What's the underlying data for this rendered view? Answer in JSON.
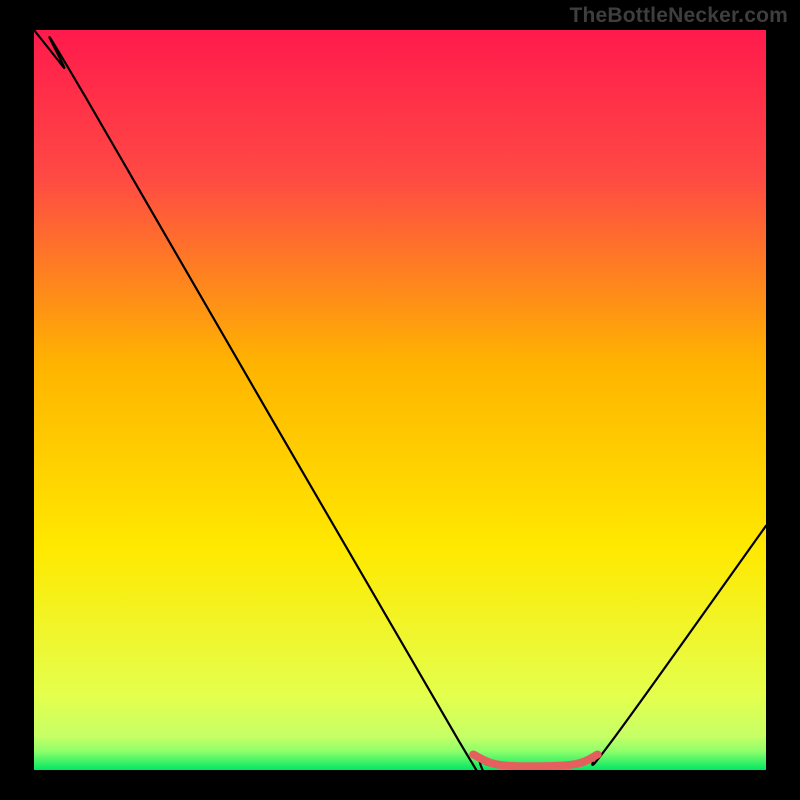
{
  "watermark": "TheBottleNecker.com",
  "chart_data": {
    "type": "line",
    "title": "",
    "xlabel": "",
    "ylabel": "",
    "xlim": [
      0,
      100
    ],
    "ylim": [
      0,
      100
    ],
    "gradient_stops": [
      {
        "offset": 0,
        "color": "#ff1a4c"
      },
      {
        "offset": 0.2,
        "color": "#ff4a44"
      },
      {
        "offset": 0.45,
        "color": "#ffb300"
      },
      {
        "offset": 0.7,
        "color": "#ffe900"
      },
      {
        "offset": 0.9,
        "color": "#e4ff4d"
      },
      {
        "offset": 0.955,
        "color": "#c6ff66"
      },
      {
        "offset": 0.975,
        "color": "#8cff6a"
      },
      {
        "offset": 1.0,
        "color": "#00e765"
      }
    ],
    "series": [
      {
        "name": "curve",
        "color": "#000000",
        "points": [
          {
            "x": 0,
            "y": 100
          },
          {
            "x": 4,
            "y": 95
          },
          {
            "x": 7,
            "y": 91
          },
          {
            "x": 58,
            "y": 4
          },
          {
            "x": 61,
            "y": 1.2
          },
          {
            "x": 64,
            "y": 0.5
          },
          {
            "x": 73,
            "y": 0.5
          },
          {
            "x": 76,
            "y": 1.2
          },
          {
            "x": 79,
            "y": 4
          },
          {
            "x": 100,
            "y": 33
          }
        ]
      },
      {
        "name": "highlight",
        "color": "#e4605f",
        "points": [
          {
            "x": 60,
            "y": 2.1
          },
          {
            "x": 63,
            "y": 0.8
          },
          {
            "x": 68,
            "y": 0.5
          },
          {
            "x": 74,
            "y": 0.8
          },
          {
            "x": 77,
            "y": 2.1
          }
        ]
      }
    ]
  }
}
